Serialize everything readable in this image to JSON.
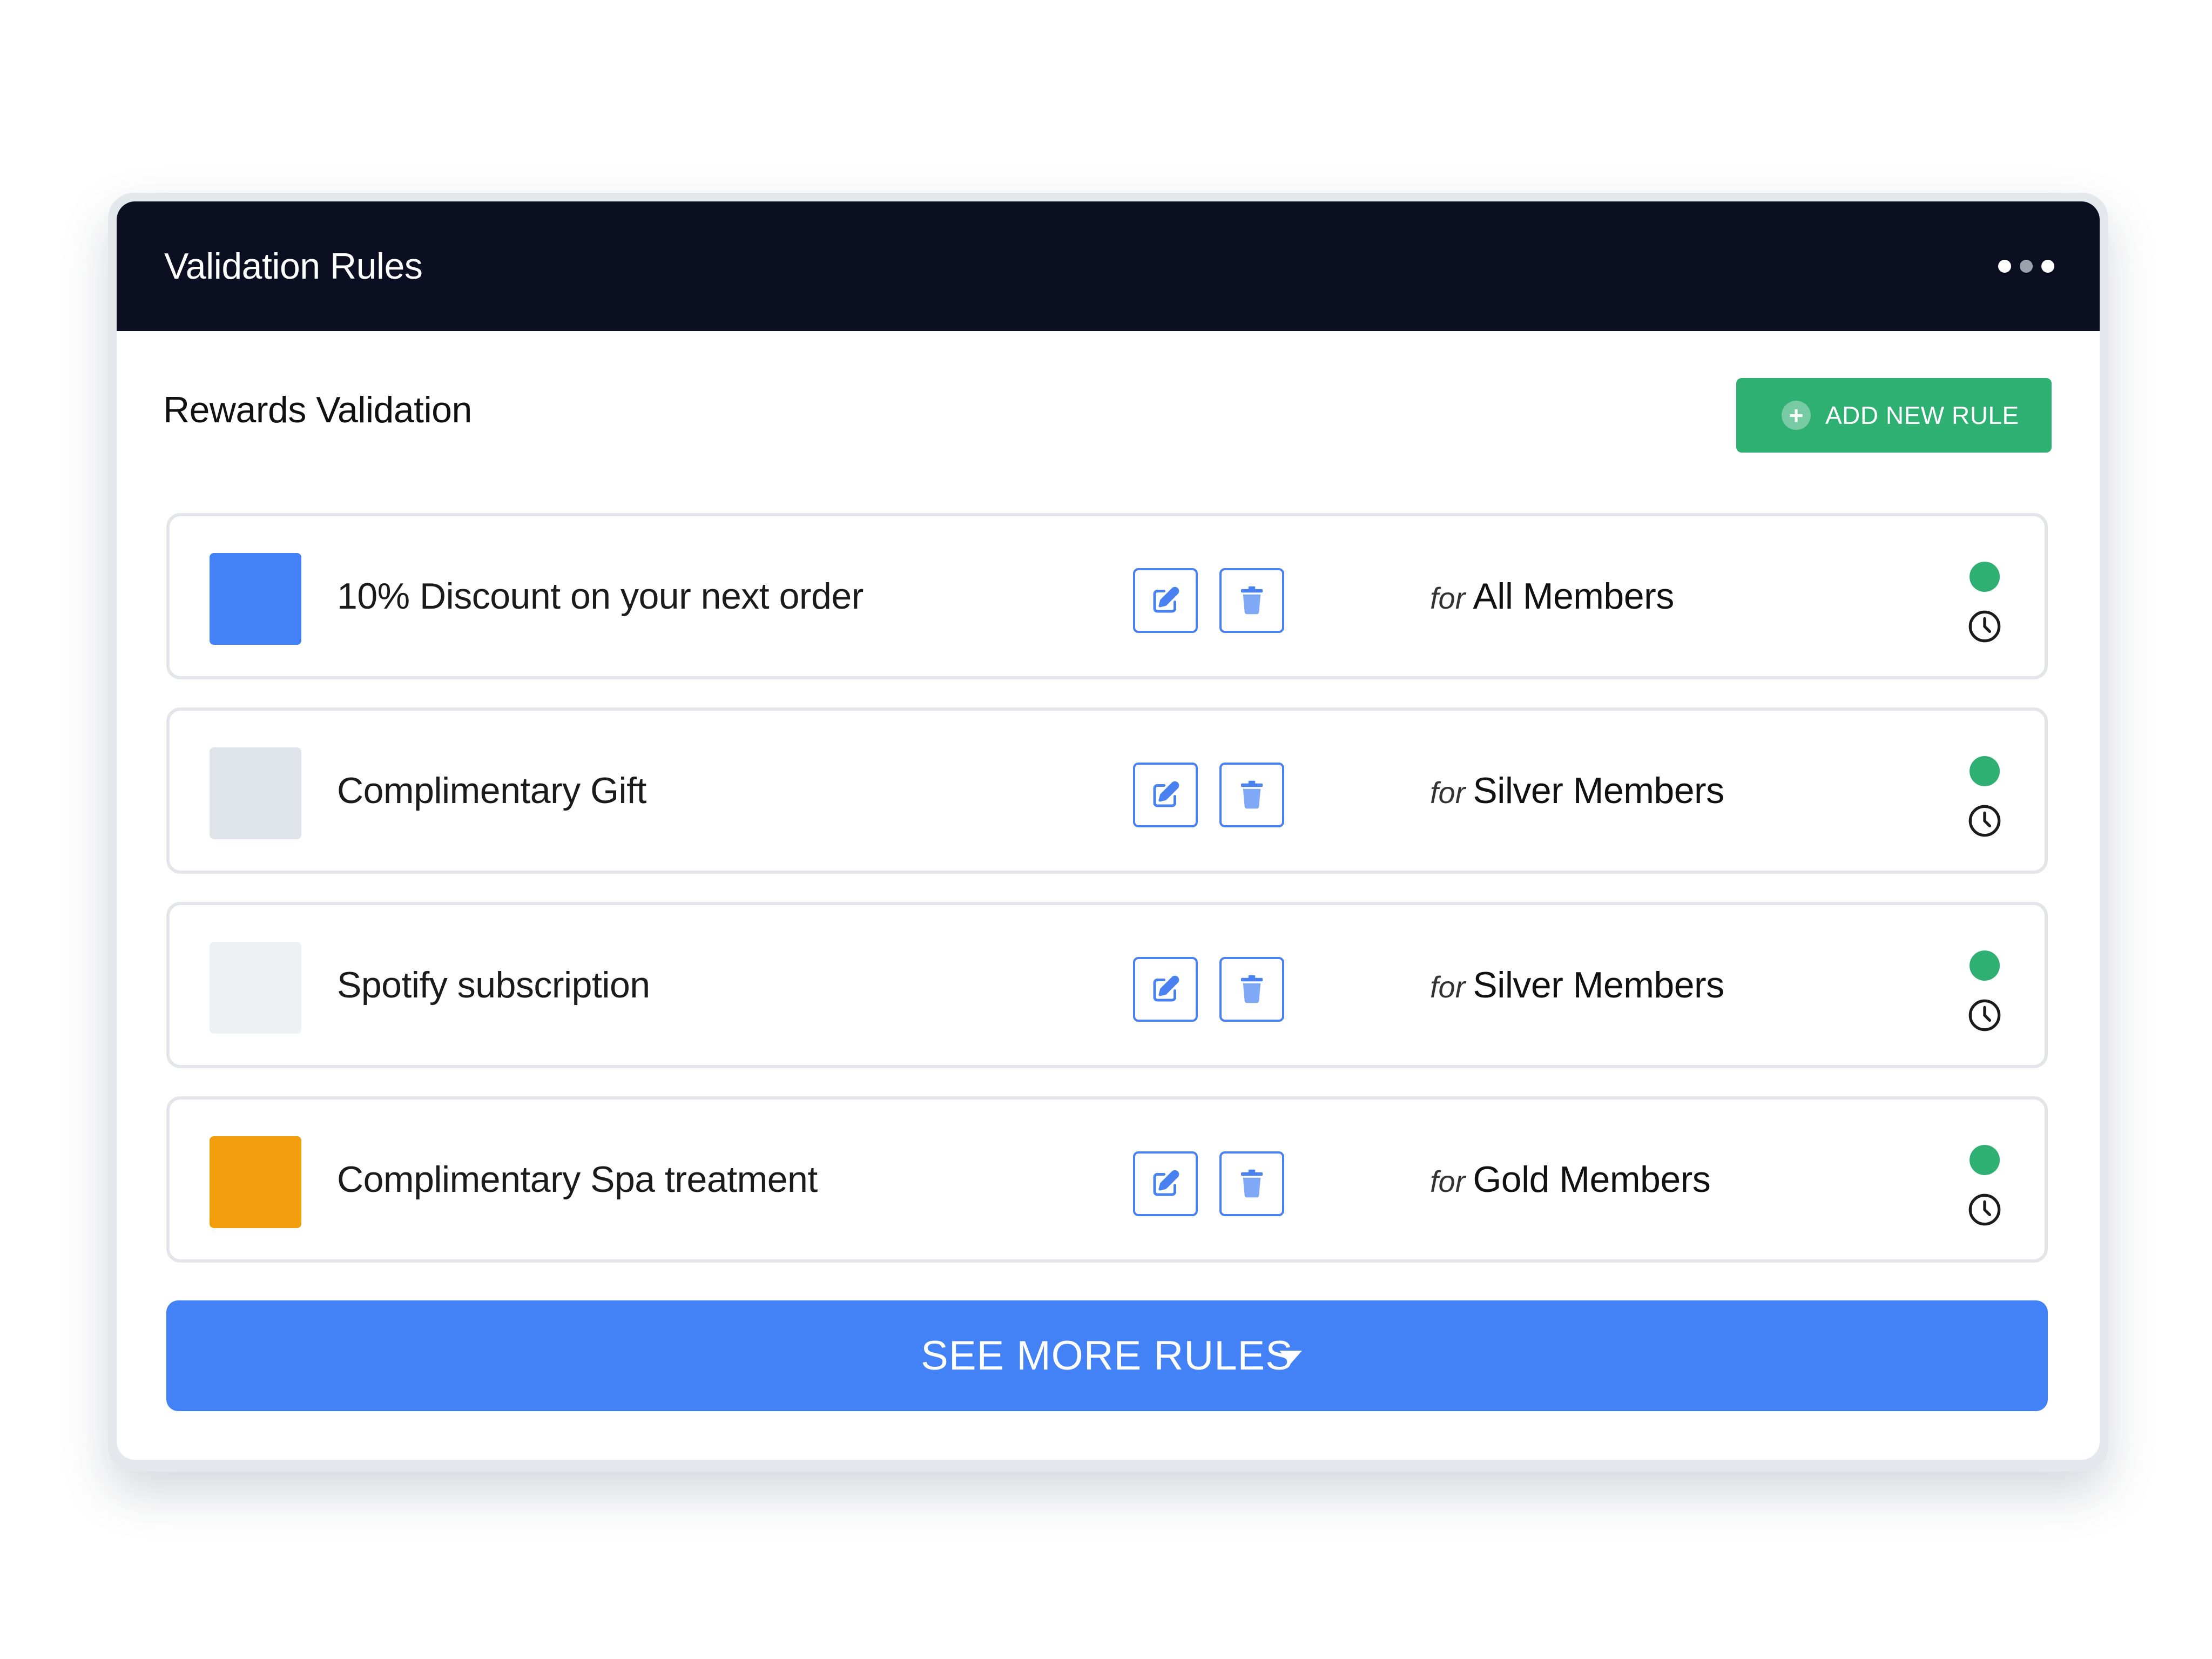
{
  "header": {
    "title": "Validation Rules",
    "menu_icon": "more-dots-icon"
  },
  "section": {
    "title": "Rewards Validation",
    "add_button_label": "ADD NEW RULE",
    "add_button_icon": "plus-circle-icon"
  },
  "rules": [
    {
      "name": "10% Discount on your next order",
      "for_label": "for",
      "audience": "All Members",
      "color": "#4381f6",
      "status": "active"
    },
    {
      "name": "Complimentary Gift",
      "for_label": "for",
      "audience": "Silver Members",
      "color": "#dfe3ea",
      "status": "active"
    },
    {
      "name": "Spotify subscription",
      "for_label": "for",
      "audience": "Silver Members",
      "color": "#eef0f3",
      "status": "active"
    },
    {
      "name": "Complimentary Spa treatment",
      "for_label": "for",
      "audience": "Gold Members",
      "color": "#f29e0c",
      "status": "active"
    }
  ],
  "row_icons": {
    "edit": "edit-icon",
    "delete": "trash-icon",
    "status": "status-dot-icon",
    "schedule": "clock-icon"
  },
  "footer": {
    "see_more_label": "SEE MORE RULES",
    "see_more_icon": "caret-down-icon"
  },
  "colors": {
    "header_bg": "#0c0f21",
    "accent_green": "#2eb073",
    "accent_blue": "#4381f6",
    "icon_blue": "#4a81f0"
  }
}
